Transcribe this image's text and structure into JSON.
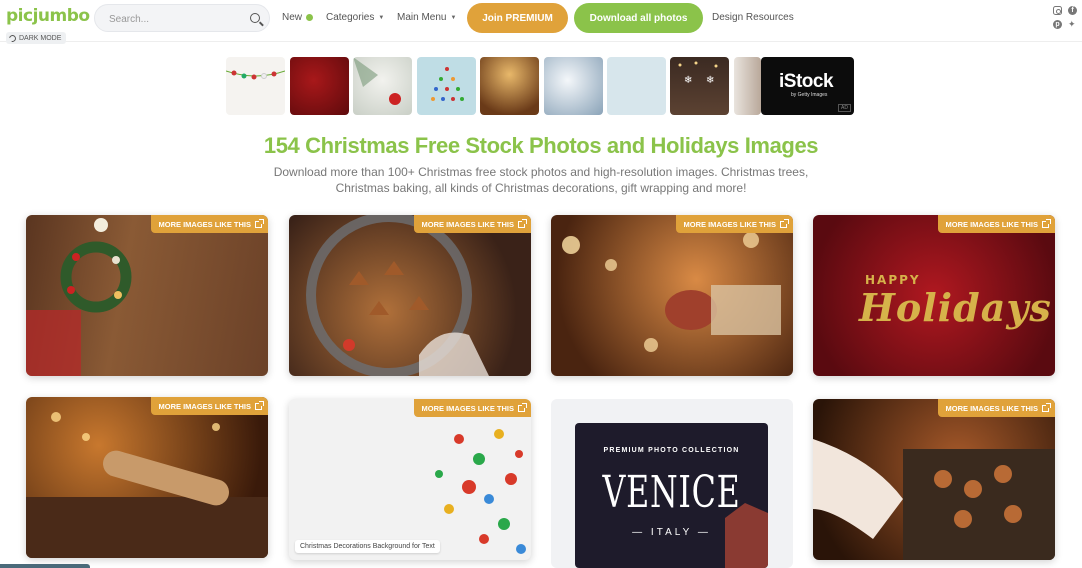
{
  "header": {
    "logo": "picjumbo",
    "dark_mode_label": "DARK MODE",
    "search_placeholder": "Search...",
    "nav": {
      "new_label": "New",
      "categories_label": "Categories",
      "main_menu_label": "Main Menu",
      "design_resources_label": "Design Resources"
    },
    "join_premium_label": "Join PREMIUM",
    "download_all_label": "Download all photos",
    "social_icons": [
      "instagram-icon",
      "facebook-icon",
      "pinterest-icon",
      "twitter-icon"
    ]
  },
  "ad": {
    "brand": "iStock",
    "sub": "by Getty Images",
    "badge": "AD"
  },
  "page": {
    "title": "154 Christmas Free Stock Photos and Holidays Images",
    "description": "Download more than 100+ Christmas free stock photos and high-resolution images. Christmas trees, Christmas baking, all kinds of Christmas decorations, gift wrapping and more!"
  },
  "cards": {
    "more_label": "MORE IMAGES LIKE THIS",
    "holidays_line1": "HAPPY",
    "holidays_line2": "Holidays",
    "decorations_caption": "Christmas Decorations Background for Text",
    "venice": {
      "collection": "PREMIUM PHOTO COLLECTION",
      "title": "VENICE",
      "subtitle": "— ITALY —"
    }
  },
  "colors": {
    "brand_green": "#8bc34a",
    "premium_orange": "#e0a23a"
  }
}
